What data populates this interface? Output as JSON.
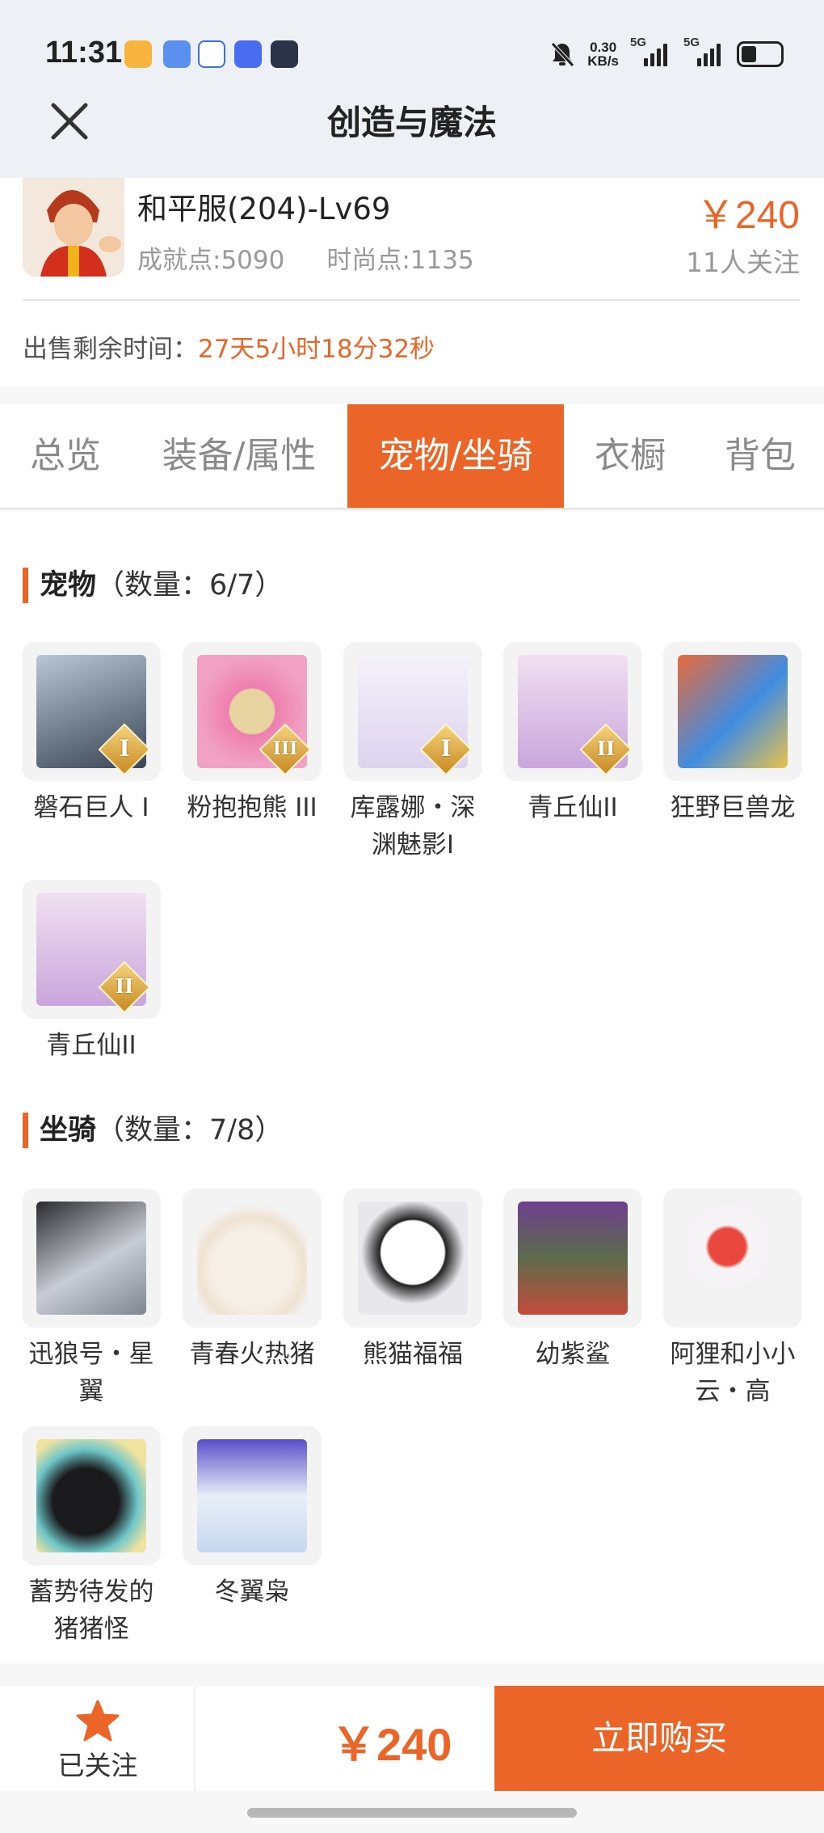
{
  "status_bar": {
    "time": "11:31",
    "net_speed_value": "0.30",
    "net_speed_unit": "KB/s",
    "sim1_label": "5G",
    "sim2_label": "5G"
  },
  "header": {
    "title": "创造与魔法",
    "close_icon": "close-icon"
  },
  "character": {
    "name": "和平服(204)-Lv69",
    "achievement": "成就点:5090",
    "fashion": "时尚点:1135",
    "price": "￥240",
    "followers": "11人关注",
    "sale_time_label": "出售剩余时间：",
    "sale_time_value": "27天5小时18分32秒"
  },
  "tabs": [
    {
      "label": "总览",
      "active": false
    },
    {
      "label": "装备/属性",
      "active": false
    },
    {
      "label": "宠物/坐骑",
      "active": true
    },
    {
      "label": "衣橱",
      "active": false
    },
    {
      "label": "背包",
      "active": false
    }
  ],
  "pets": {
    "title": "宠物",
    "count": "（数量：6/7）",
    "items": [
      {
        "label": "磐石巨人 I",
        "badge": "I"
      },
      {
        "label": "粉抱抱熊 III",
        "badge": "III"
      },
      {
        "label": "库露娜・深渊魅影I",
        "badge": "I"
      },
      {
        "label": "青丘仙II",
        "badge": "II"
      },
      {
        "label": "狂野巨兽龙",
        "badge": ""
      },
      {
        "label": "青丘仙II",
        "badge": "II"
      }
    ]
  },
  "mounts": {
    "title": "坐骑",
    "count": "（数量：7/8）",
    "items": [
      {
        "label": "迅狼号・星翼"
      },
      {
        "label": "青春火热猪"
      },
      {
        "label": "熊猫福福"
      },
      {
        "label": "幼紫鲨"
      },
      {
        "label": "阿狸和小小云・高"
      },
      {
        "label": "蓄势待发的猪猪怪"
      },
      {
        "label": "冬翼枭"
      }
    ]
  },
  "bottom_bar": {
    "follow_label": "已关注",
    "price": "￥240",
    "buy_label": "立即购买"
  },
  "colors": {
    "accent": "#ec6528",
    "header_bg": "#edf0f5"
  }
}
